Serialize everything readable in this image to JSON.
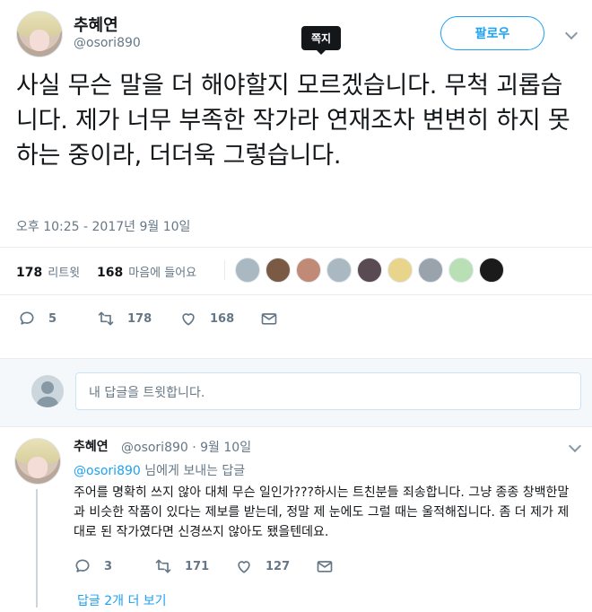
{
  "tweet": {
    "author_name": "추혜연",
    "author_handle": "@osori890",
    "tooltip": "쪽지",
    "follow_label": "팔로우",
    "text": "사실 무슨 말을 더 해야할지 모르겠습니다. 무척 괴롭습니다. 제가 너무 부족한 작가라 연재조차 변변히 하지 못하는 중이라, 더더욱 그렇습니다.",
    "timestamp": "오후 10:25 - 2017년 9월 10일",
    "retweets_count": "178",
    "retweets_label": "리트윗",
    "likes_count": "168",
    "likes_label": "마음에 들어요",
    "actions": {
      "reply": "5",
      "retweet": "178",
      "like": "168"
    }
  },
  "reply_box": {
    "placeholder": "내 답글을 트윗합니다."
  },
  "reply": {
    "author_name": "추혜연",
    "meta": "@osori890 · 9월 10일",
    "to_handle": "@osori890",
    "to_suffix": " 님에게 보내는 답글",
    "text": "주어를 명확히 쓰지 않아 대체 무슨 일인가???하시는 트친분들 죄송합니다. 그냥 종종 창백한말과 비슷한 작품이 있다는 제보를 받는데, 정말 제 눈에도 그럴 때는 울적해집니다. 좀 더 제가 제대로 된 작가였다면 신경쓰지 않아도 됐을텐데요.",
    "actions": {
      "reply": "3",
      "retweet": "171",
      "like": "127"
    },
    "more": "답글 2개 더 보기"
  },
  "colors": {
    "accent": "#1da1f2",
    "muted": "#657786",
    "text": "#14171a"
  },
  "liker_colors": [
    "#aab8c2",
    "#7a5a44",
    "#c08a77",
    "#aab8c2",
    "#5a4a52",
    "#e8d48a",
    "#9aa3ab",
    "#b9e0b5",
    "#1b1b1b"
  ]
}
